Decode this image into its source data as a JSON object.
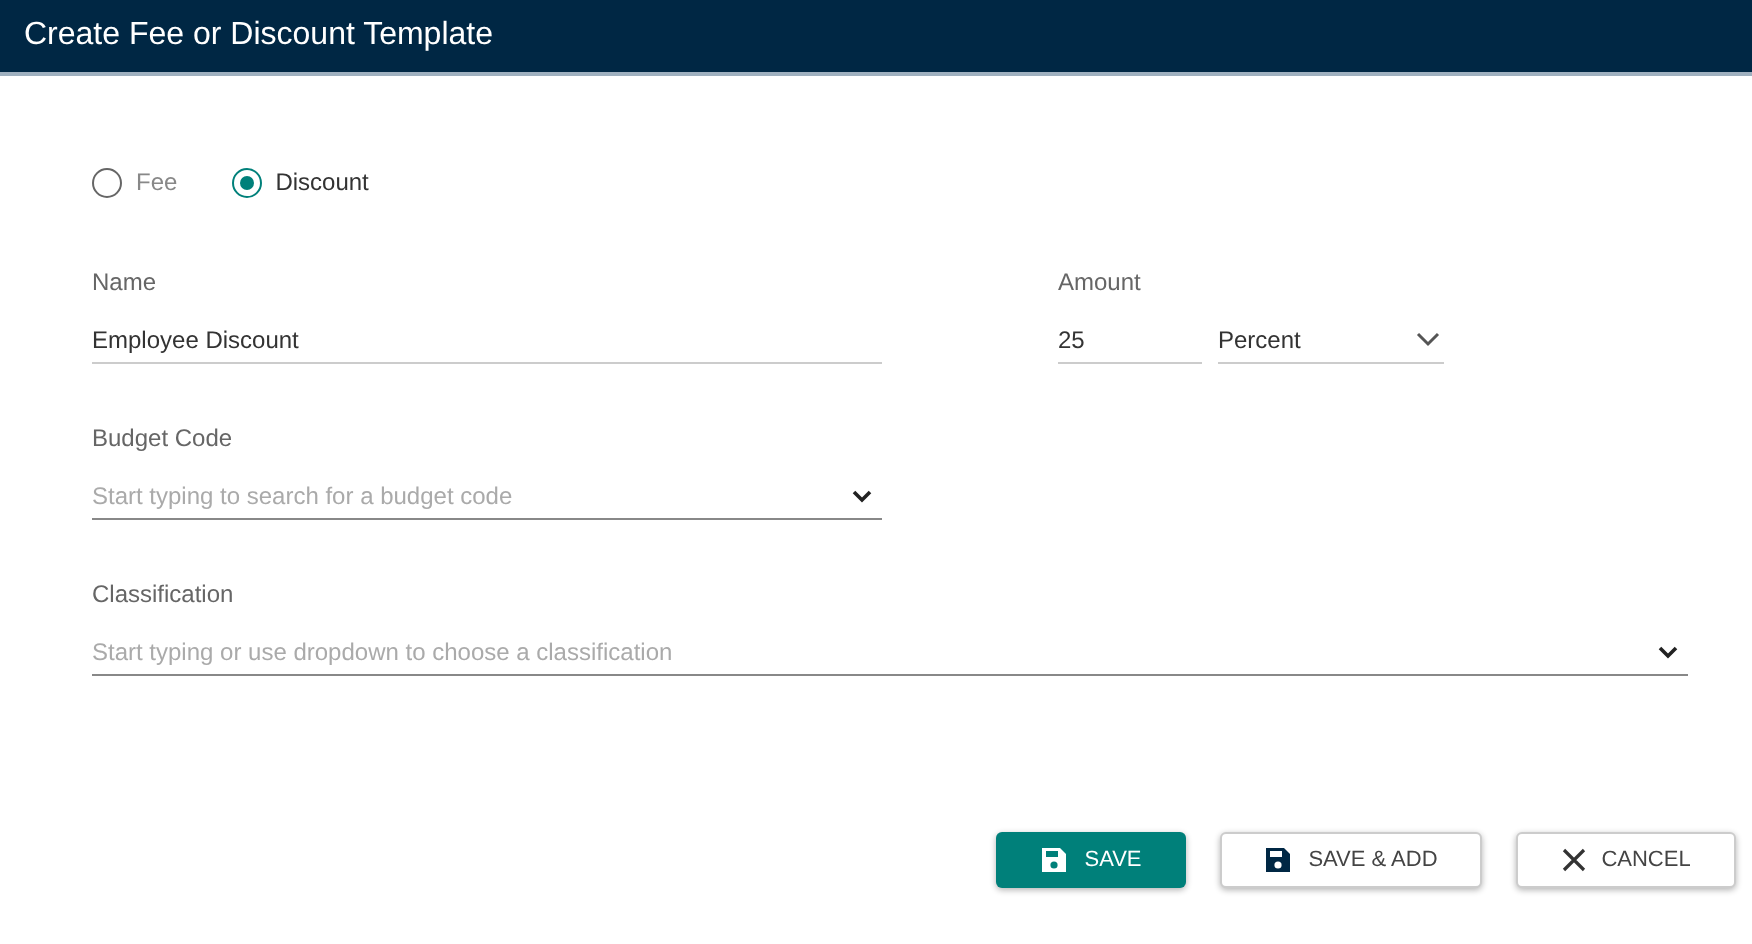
{
  "window": {
    "title": "Create Fee or Discount Template"
  },
  "type_options": [
    {
      "label": "Fee",
      "selected": false
    },
    {
      "label": "Discount",
      "selected": true
    }
  ],
  "name": {
    "label": "Name",
    "value": "Employee Discount"
  },
  "amount": {
    "label": "Amount",
    "value": "25",
    "unit": "Percent"
  },
  "budget_code": {
    "label": "Budget Code",
    "placeholder": "Start typing to search for a budget code"
  },
  "classification": {
    "label": "Classification",
    "placeholder": "Start typing or use dropdown to choose a classification"
  },
  "buttons": [
    {
      "label": "SAVE",
      "kind": "primary"
    },
    {
      "label": "SAVE & ADD",
      "kind": "save"
    },
    {
      "label": "CANCEL",
      "kind": "cancel"
    }
  ]
}
